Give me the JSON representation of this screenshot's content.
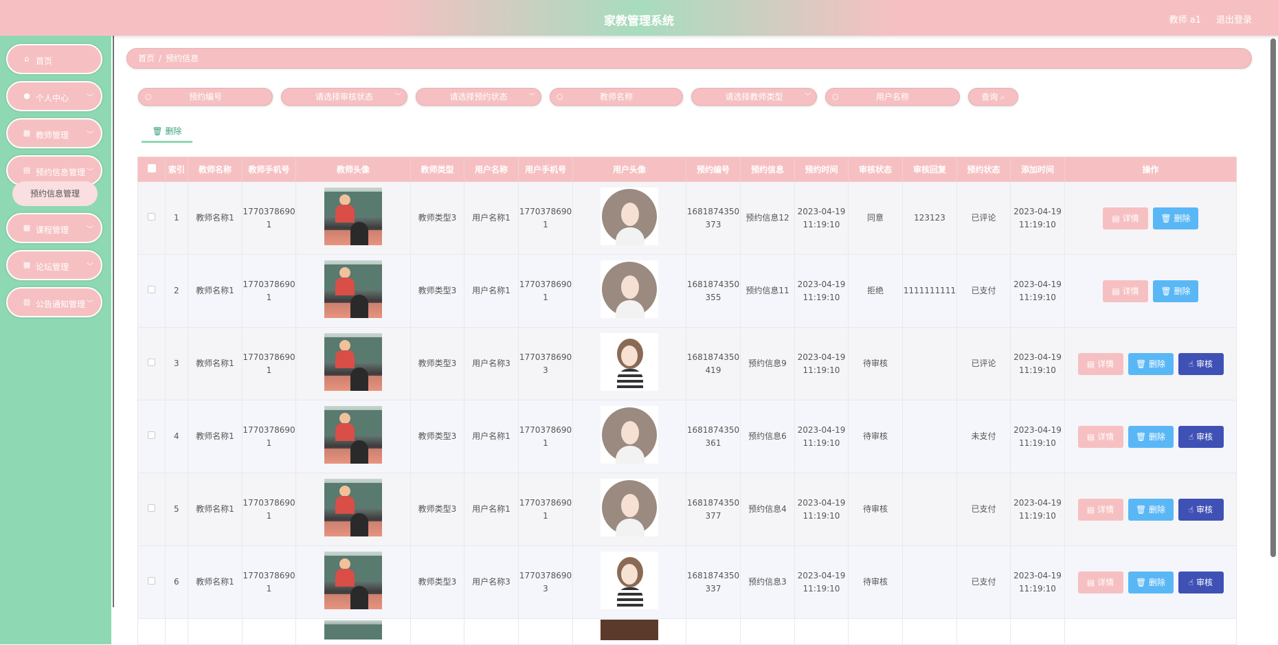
{
  "header": {
    "title": "家教管理系统",
    "user": "教师 a1",
    "logout": "退出登录"
  },
  "sidebar": {
    "items": [
      {
        "label": "首页",
        "icon": "home-icon",
        "glyph": "⌂"
      },
      {
        "label": "个人中心",
        "icon": "user-icon",
        "glyph": "●"
      },
      {
        "label": "教师管理",
        "icon": "grid-icon",
        "glyph": "▦"
      },
      {
        "label": "预约信息管理",
        "icon": "reservation-icon",
        "glyph": "▤"
      },
      {
        "label": "课程管理",
        "icon": "grid-icon",
        "glyph": "▦"
      },
      {
        "label": "论坛管理",
        "icon": "grid-icon",
        "glyph": "▦"
      },
      {
        "label": "公告通知管理",
        "icon": "list-icon",
        "glyph": "▥"
      }
    ],
    "submenu": {
      "label": "预约信息管理"
    }
  },
  "breadcrumb": {
    "home": "首页",
    "current": "预约信息"
  },
  "filters": {
    "reservation_no": "预约编号",
    "audit_status": "请选择审核状态",
    "reservation_status": "请选择预约状态",
    "teacher_name": "教师名称",
    "teacher_type": "请选择教师类型",
    "user_name": "用户名称",
    "search_label": "查询"
  },
  "toolbar": {
    "delete_label": "删除"
  },
  "table": {
    "headers": [
      "索引",
      "教师名称",
      "教师手机号",
      "教师头像",
      "教师类型",
      "用户名称",
      "用户手机号",
      "用户头像",
      "预约编号",
      "预约信息",
      "预约时间",
      "审核状态",
      "审核回复",
      "预约状态",
      "添加时间",
      "操作"
    ],
    "actions": {
      "detail": "详情",
      "delete": "删除",
      "audit": "审核"
    },
    "rows": [
      {
        "index": "1",
        "teacher_name": "教师名称1",
        "teacher_phone": "17703786901",
        "teacher_type": "教师类型3",
        "user_name": "用户名称1",
        "user_phone": "17703786901",
        "reservation_no": "1681874350373",
        "info": "预约信息12",
        "time": "2023-04-19 11:19:10",
        "audit": "同意",
        "reply": "123123",
        "status": "已评论",
        "added": "2023-04-19 11:19:10"
      },
      {
        "index": "2",
        "teacher_name": "教师名称1",
        "teacher_phone": "17703786901",
        "teacher_type": "教师类型3",
        "user_name": "用户名称1",
        "user_phone": "17703786901",
        "reservation_no": "1681874350355",
        "info": "预约信息11",
        "time": "2023-04-19 11:19:10",
        "audit": "拒绝",
        "reply": "1111111111",
        "status": "已支付",
        "added": "2023-04-19 11:19:10"
      },
      {
        "index": "3",
        "teacher_name": "教师名称1",
        "teacher_phone": "17703786901",
        "teacher_type": "教师类型3",
        "user_name": "用户名称3",
        "user_phone": "17703786903",
        "reservation_no": "1681874350419",
        "info": "预约信息9",
        "time": "2023-04-19 11:19:10",
        "audit": "待审核",
        "reply": "",
        "status": "已评论",
        "added": "2023-04-19 11:19:10"
      },
      {
        "index": "4",
        "teacher_name": "教师名称1",
        "teacher_phone": "17703786901",
        "teacher_type": "教师类型3",
        "user_name": "用户名称1",
        "user_phone": "17703786901",
        "reservation_no": "1681874350361",
        "info": "预约信息6",
        "time": "2023-04-19 11:19:10",
        "audit": "待审核",
        "reply": "",
        "status": "未支付",
        "added": "2023-04-19 11:19:10"
      },
      {
        "index": "5",
        "teacher_name": "教师名称1",
        "teacher_phone": "17703786901",
        "teacher_type": "教师类型3",
        "user_name": "用户名称1",
        "user_phone": "17703786901",
        "reservation_no": "1681874350377",
        "info": "预约信息4",
        "time": "2023-04-19 11:19:10",
        "audit": "待审核",
        "reply": "",
        "status": "已支付",
        "added": "2023-04-19 11:19:10"
      },
      {
        "index": "6",
        "teacher_name": "教师名称1",
        "teacher_phone": "17703786901",
        "teacher_type": "教师类型3",
        "user_name": "用户名称3",
        "user_phone": "17703786903",
        "reservation_no": "1681874350337",
        "info": "预约信息3",
        "time": "2023-04-19 11:19:10",
        "audit": "待审核",
        "reply": "",
        "status": "已支付",
        "added": "2023-04-19 11:19:10"
      }
    ]
  },
  "colors": {
    "primary_pink": "#f6c0c2",
    "sidebar_green": "#8ed8b3",
    "delete_blue": "#5ab7f5",
    "audit_indigo": "#3f51b5"
  }
}
